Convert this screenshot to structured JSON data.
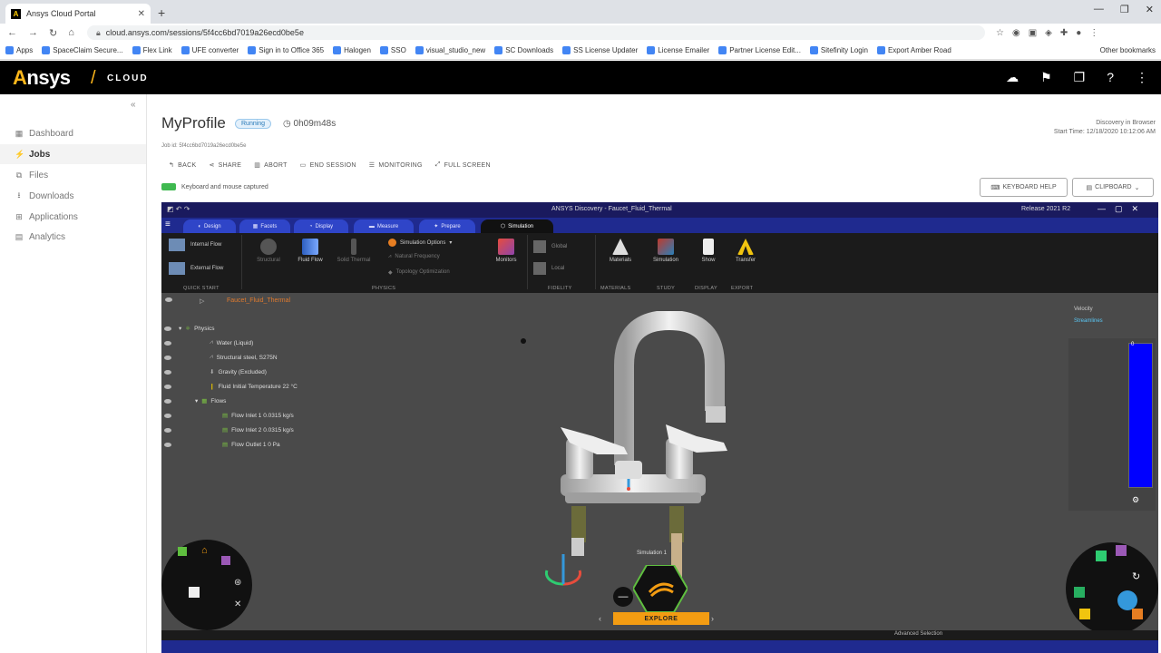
{
  "browser": {
    "tab_title": "Ansys Cloud Portal",
    "tab_close": "✕",
    "new_tab": "+",
    "url": "cloud.ansys.com/sessions/5f4cc6bd7019a26ecd0be5e",
    "bookmarks": [
      "Apps",
      "SpaceClaim Secure...",
      "Flex Link",
      "UFE converter",
      "Sign in to Office 365",
      "Halogen",
      "SSO",
      "visual_studio_new",
      "SC Downloads",
      "SS License Updater",
      "License Emailer",
      "Partner License Edit...",
      "Sitefinity Login",
      "Export Amber Road"
    ],
    "other_bookmarks": "Other bookmarks"
  },
  "app": {
    "brand": "nsys",
    "brand_a": "A",
    "brand_slash": "/",
    "brand_sub": "CLOUD"
  },
  "sidebar": {
    "collapse": "«",
    "items": [
      {
        "label": "Dashboard",
        "icon": "dashboard-icon",
        "glyph": "▦"
      },
      {
        "label": "Jobs",
        "icon": "jobs-icon",
        "glyph": "⚡"
      },
      {
        "label": "Files",
        "icon": "files-icon",
        "glyph": "⧉"
      },
      {
        "label": "Downloads",
        "icon": "download-icon",
        "glyph": "⭳"
      },
      {
        "label": "Applications",
        "icon": "applications-icon",
        "glyph": "⊞"
      },
      {
        "label": "Analytics",
        "icon": "analytics-icon",
        "glyph": "▤"
      }
    ]
  },
  "job": {
    "title": "MyProfile",
    "status": "Running",
    "elapsed": "0h09m48s",
    "job_id": "Job id: 5f4cc6bd7019a26ecd0be5e",
    "right_app": "Discovery in Browser",
    "start_time": "Start Time: 12/18/2020 10:12:06 AM",
    "captured": "Keyboard and mouse captured",
    "toolbar": {
      "back": "BACK",
      "share": "SHARE",
      "abort": "ABORT",
      "end_session": "END SESSION",
      "monitoring": "MONITORING",
      "fullscreen": "FULL SCREEN"
    },
    "keyboard_help": "KEYBOARD HELP",
    "clipboard": "CLIPBOARD"
  },
  "discovery": {
    "title": "ANSYS Discovery - Faucet_Fluid_Thermal",
    "release": "Release 2021 R2",
    "tabs": [
      "Design",
      "Facets",
      "Display",
      "Measure",
      "Prepare",
      "Simulation"
    ],
    "active_tab": "Simulation",
    "ribbon": {
      "internal_flow": "Internal Flow",
      "external_flow": "External Flow",
      "quick_start": "QUICK START",
      "structural": "Structural",
      "fluid_flow": "Fluid Flow",
      "solid_thermal": "Solid Thermal",
      "simulation_options": "Simulation Options",
      "natural_frequency": "Natural Frequency",
      "topology_optimization": "Topology Optimization",
      "physics": "PHYSICS",
      "monitors": "Monitors",
      "global": "Global",
      "local": "Local",
      "fidelity": "FIDELITY",
      "materials": "Materials",
      "materials_group": "MATERIALS",
      "simulation": "Simulation",
      "study": "STUDY",
      "show": "Show",
      "display": "DISPLAY",
      "transfer": "Transfer",
      "export": "EXPORT"
    },
    "tree": {
      "root": "Faucet_Fluid_Thermal",
      "nodes": [
        {
          "label": "Physics",
          "indent": 0
        },
        {
          "label": "Water (Liquid)",
          "indent": 1
        },
        {
          "label": "Structural steel, S275N",
          "indent": 1
        },
        {
          "label": "Gravity     (Excluded)",
          "indent": 1
        },
        {
          "label": "Fluid Initial Temperature     22 °C",
          "indent": 1
        },
        {
          "label": "Flows",
          "indent": 1
        },
        {
          "label": "Flow Inlet 1     0.0315 kg/s",
          "indent": 2
        },
        {
          "label": "Flow Inlet 2     0.0315 kg/s",
          "indent": 2
        },
        {
          "label": "Flow Outlet 1     0 Pa",
          "indent": 2
        }
      ]
    },
    "legend_title": "Velocity",
    "legend_sub": "Streamlines",
    "legend_zero": "0",
    "simulation_label": "Simulation 1",
    "explore": "EXPLORE",
    "explore_left": "‹",
    "explore_right": "›",
    "bottom_status": "Advanced Selection"
  },
  "colors": {
    "brand_yellow": "#ffb71b",
    "discovery_blue": "#1f2a8f",
    "explore_orange": "#f39c12",
    "legend_blue": "#0000ff"
  }
}
